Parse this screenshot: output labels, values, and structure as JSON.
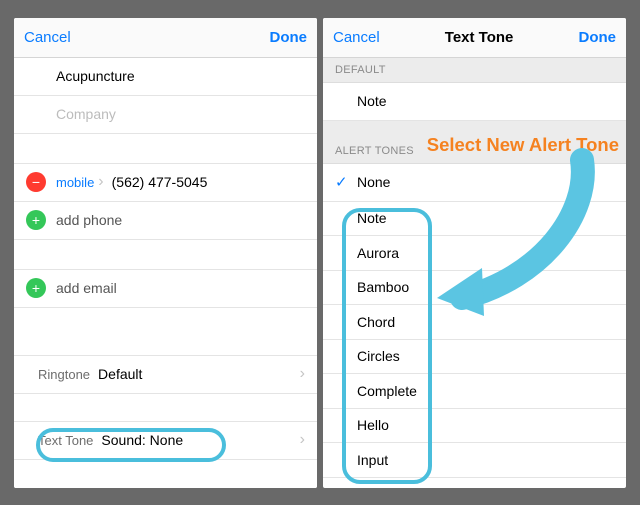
{
  "left": {
    "nav": {
      "cancel": "Cancel",
      "done": "Done"
    },
    "fields": {
      "company_value": "Acupuncture",
      "company_placeholder": "Company",
      "phone_label": "mobile",
      "phone_value": "(562) 477-5045",
      "add_phone": "add phone",
      "add_email": "add email",
      "ringtone_label": "Ringtone",
      "ringtone_value": "Default",
      "texttone_label": "Text Tone",
      "texttone_value": "Sound: None"
    }
  },
  "right": {
    "nav": {
      "cancel": "Cancel",
      "title": "Text Tone",
      "done": "Done"
    },
    "section_default": "DEFAULT",
    "default_tone": "Note",
    "section_alert": "ALERT TONES",
    "selected": "None",
    "tones": [
      "Note",
      "Aurora",
      "Bamboo",
      "Chord",
      "Circles",
      "Complete",
      "Hello",
      "Input"
    ]
  },
  "callout": "Select New Alert Tone"
}
